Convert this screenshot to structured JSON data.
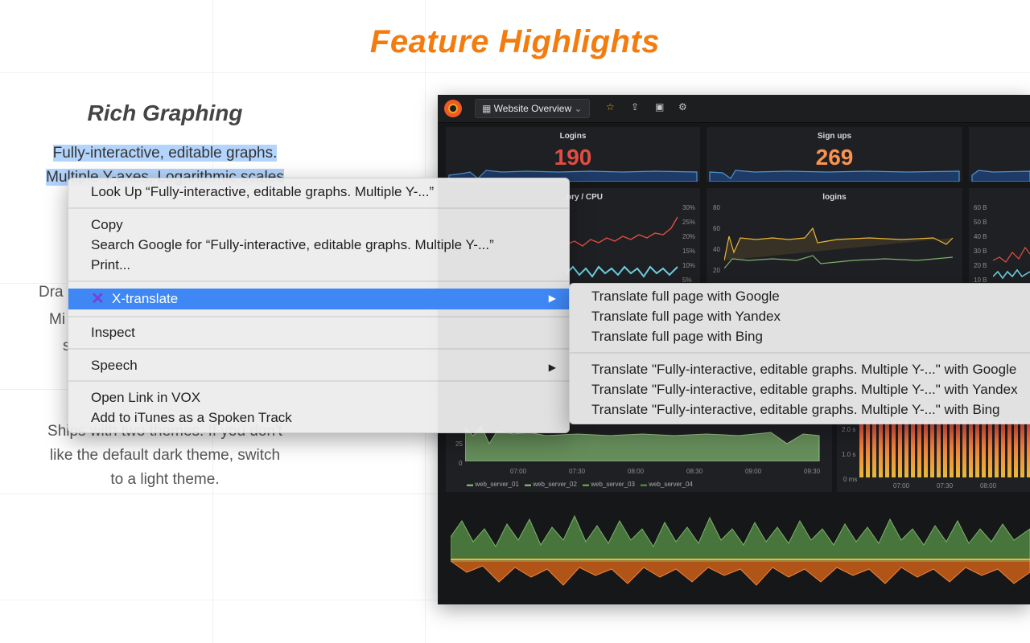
{
  "page": {
    "title": "Feature Highlights",
    "feature": {
      "title": "Rich Graphing",
      "line1": "Fully-interactive, editable graphs.",
      "line2": "Multiple Y-axes, Logarithmic scales",
      "frag1": "Dra",
      "frag2": "Mi",
      "frag3": "s",
      "themes_line1": "Ships with two themes. If you don't",
      "themes_line2": "like the default dark theme, switch",
      "themes_line3": "to a light theme."
    }
  },
  "dashboard": {
    "name": "Website Overview",
    "panels": {
      "logins_stat": {
        "title": "Logins",
        "value": "190",
        "color": "#e24d42"
      },
      "signups_stat": {
        "title": "Sign ups",
        "value": "269",
        "color": "#f9934e"
      },
      "cpu": {
        "title": "ory / CPU",
        "yticks": [
          "30%",
          "25%",
          "20%",
          "15%",
          "10%",
          "5%"
        ]
      },
      "logins_graph": {
        "title": "logins",
        "yticks": [
          "80",
          "60",
          "40",
          "20"
        ]
      },
      "memory": {
        "yticks": [
          "60 B",
          "50 B",
          "40 B",
          "30 B",
          "20 B",
          "10 B"
        ]
      },
      "traffic": {
        "yticks": [
          "25",
          "0"
        ],
        "xticks": [
          "07:00",
          "07:30",
          "08:00",
          "08:30",
          "09:00",
          "09:30"
        ],
        "legend": [
          "web_server_01",
          "web_server_02",
          "web_server_03",
          "web_server_04"
        ]
      },
      "latency": {
        "yticks": [
          "2.0 s",
          "1.0 s",
          "0 ms"
        ],
        "xticks": [
          "07:00",
          "07:30",
          "08:00"
        ]
      }
    }
  },
  "context_menu": {
    "look_up": "Look Up “Fully-interactive, editable graphs. Multiple Y-...”",
    "copy": "Copy",
    "search_google": "Search Google for “Fully-interactive, editable graphs. Multiple Y-...”",
    "print": "Print...",
    "x_translate": "X-translate",
    "inspect": "Inspect",
    "speech": "Speech",
    "open_vox": "Open Link in VOX",
    "add_itunes": "Add to iTunes as a Spoken Track"
  },
  "submenu": {
    "google_page": "Translate full page with Google",
    "yandex_page": "Translate full page with Yandex",
    "bing_page": "Translate full page with Bing",
    "sel_google": "Translate \"Fully-interactive, editable graphs. Multiple Y-...\" with Google",
    "sel_yandex": "Translate \"Fully-interactive, editable graphs. Multiple Y-...\" with Yandex",
    "sel_bing": "Translate \"Fully-interactive, editable graphs. Multiple Y-...\" with Bing"
  },
  "colors": {
    "accent": "#f47c0e",
    "highlight": "#b3d4fc",
    "menu_selected": "#3f87f5"
  }
}
